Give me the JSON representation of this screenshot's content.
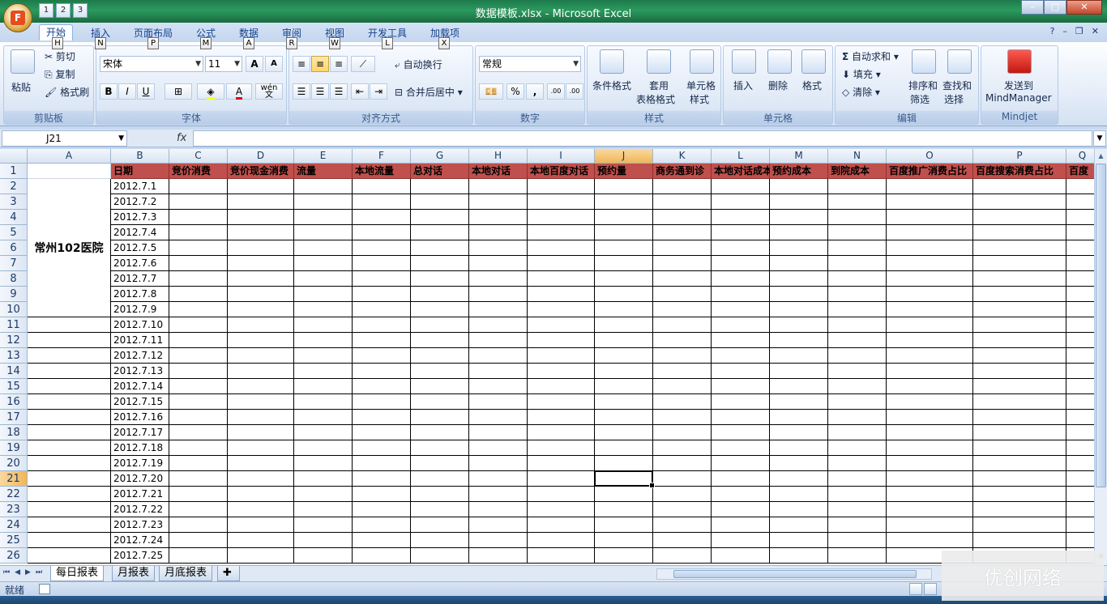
{
  "window": {
    "title": "数据模板.xlsx - Microsoft Excel"
  },
  "office_button": {
    "label": "F"
  },
  "qat": {
    "keytips": [
      "1",
      "2",
      "3"
    ]
  },
  "tabs": [
    {
      "label": "开始",
      "key": "H",
      "active": true
    },
    {
      "label": "插入",
      "key": "N"
    },
    {
      "label": "页面布局",
      "key": "P"
    },
    {
      "label": "公式",
      "key": "M"
    },
    {
      "label": "数据",
      "key": "A"
    },
    {
      "label": "审阅",
      "key": "R"
    },
    {
      "label": "视图",
      "key": "W"
    },
    {
      "label": "开发工具",
      "key": "L"
    },
    {
      "label": "加载项",
      "key": "X"
    }
  ],
  "ribbon": {
    "clipboard": {
      "title": "剪贴板",
      "paste": "粘贴",
      "cut": "剪切",
      "copy": "复制",
      "format_painter": "格式刷"
    },
    "font": {
      "title": "字体",
      "font_name": "宋体",
      "font_size": "11",
      "bold": "B",
      "italic": "I",
      "underline": "U",
      "grow": "A",
      "shrink": "A",
      "fontcolor": "A",
      "wen": "wén",
      "wen_char": "文"
    },
    "alignment": {
      "title": "对齐方式",
      "wrap_text": "自动换行",
      "merge_center": "合并后居中"
    },
    "number": {
      "title": "数字",
      "format": "常规",
      "percent": "%",
      "comma": ",",
      "inc": ".00",
      "dec": ".00"
    },
    "styles": {
      "title": "样式",
      "conditional": "条件格式",
      "table_format_1": "套用",
      "table_format_2": "表格格式",
      "cell_styles_1": "单元格",
      "cell_styles_2": "样式"
    },
    "cells": {
      "title": "单元格",
      "insert": "插入",
      "delete": "删除",
      "format": "格式"
    },
    "editing": {
      "title": "编辑",
      "autosum": "自动求和",
      "fill": "填充",
      "clear": "清除",
      "sort_1": "排序和",
      "sort_2": "筛选",
      "find_1": "查找和",
      "find_2": "选择"
    },
    "mindjet": {
      "title": "Mindjet",
      "send_1": "发送到",
      "send_2": "MindManager"
    }
  },
  "formula_bar": {
    "name_box": "J21",
    "fx": "fx",
    "value": ""
  },
  "grid": {
    "columns": [
      "A",
      "B",
      "C",
      "D",
      "E",
      "F",
      "G",
      "H",
      "I",
      "J",
      "K",
      "L",
      "M",
      "N",
      "O",
      "P",
      "Q"
    ],
    "selected_column": "J",
    "rows": [
      "1",
      "2",
      "3",
      "4",
      "5",
      "6",
      "7",
      "8",
      "9",
      "10",
      "11",
      "12",
      "13",
      "14",
      "15",
      "16",
      "17",
      "18",
      "19",
      "20",
      "21",
      "22",
      "23",
      "24",
      "25",
      "26"
    ],
    "selected_row": "21",
    "header_row": [
      "日期",
      "竞价消费",
      "竞价现金消费",
      "流量",
      "本地流量",
      "总对话",
      "本地对话",
      "本地百度对话",
      "预约量",
      "商务通到诊",
      "本地对话成本",
      "预约成本",
      "到院成本",
      "百度推广消费占比",
      "百度搜索消费占比",
      "百度"
    ],
    "merged_label": "常州102医院",
    "dates": [
      "2012.7.1",
      "2012.7.2",
      "2012.7.3",
      "2012.7.4",
      "2012.7.5",
      "2012.7.6",
      "2012.7.7",
      "2012.7.8",
      "2012.7.9",
      "2012.7.10",
      "2012.7.11",
      "2012.7.12",
      "2012.7.13",
      "2012.7.14",
      "2012.7.15",
      "2012.7.16",
      "2012.7.17",
      "2012.7.18",
      "2012.7.19",
      "2012.7.20",
      "2012.7.21",
      "2012.7.22",
      "2012.7.23",
      "2012.7.24",
      "2012.7.25"
    ],
    "header_color": "#c0504d",
    "active_cell": "J21"
  },
  "sheets": [
    {
      "label": "每日报表",
      "active": true
    },
    {
      "label": "月报表"
    },
    {
      "label": "月底报表"
    }
  ],
  "status": {
    "ready": "就绪"
  },
  "watermark": "优创网络"
}
